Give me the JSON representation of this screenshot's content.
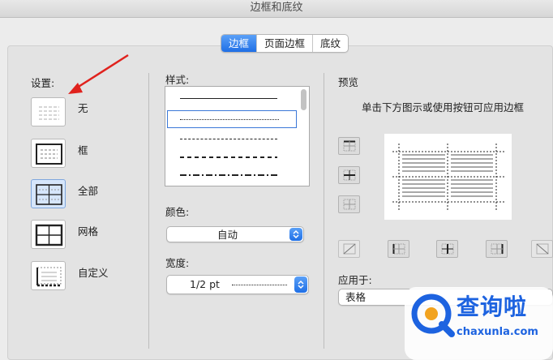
{
  "window": {
    "title": "边框和底纹"
  },
  "tabs": [
    {
      "label": "边框",
      "active": true
    },
    {
      "label": "页面边框",
      "active": false
    },
    {
      "label": "底纹",
      "active": false
    }
  ],
  "settings": {
    "heading": "设置:",
    "items": [
      {
        "name": "无",
        "icon": "border-none-icon",
        "selected": false
      },
      {
        "name": "框",
        "icon": "border-box-icon",
        "selected": false
      },
      {
        "name": "全部",
        "icon": "border-all-icon",
        "selected": true
      },
      {
        "name": "网格",
        "icon": "border-grid-icon",
        "selected": false
      },
      {
        "name": "自定义",
        "icon": "border-custom-icon",
        "selected": false
      }
    ]
  },
  "style": {
    "heading": "样式:",
    "options": [
      "solid",
      "dotted",
      "dashed-short",
      "dashed",
      "dash-dot"
    ],
    "selected": "dotted"
  },
  "color": {
    "heading": "颜色:",
    "value": "自动"
  },
  "width": {
    "heading": "宽度:",
    "value": "1/2 pt"
  },
  "preview": {
    "heading": "预览",
    "hint": "单击下方图示或使用按钮可应用边框"
  },
  "apply_to": {
    "heading": "应用于:",
    "value": "表格"
  },
  "watermark": {
    "brand": "查询啦",
    "domain": "chaxunla.com"
  },
  "colors": {
    "accent": "#1f6fe6",
    "annotation_arrow": "#e0221d",
    "watermark": "#1d63e0"
  }
}
